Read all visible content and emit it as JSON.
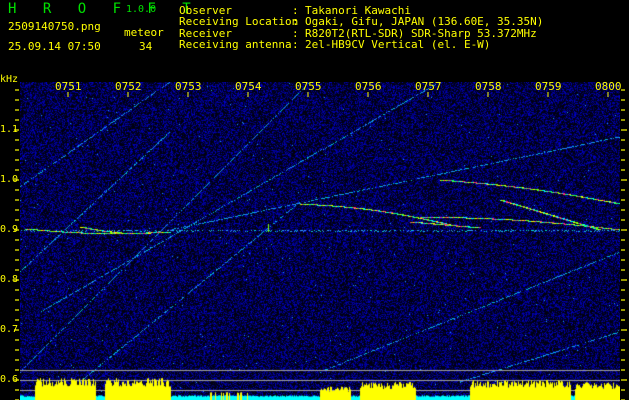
{
  "header": {
    "app_name": "H R O F F T",
    "version": "1.0.0",
    "filename": "2509140750.png",
    "datetime": "25.09.14 07:50",
    "meteor_label": "meteor",
    "meteor_count": "34",
    "info": [
      {
        "label": "Observer",
        "value": "Takanori Kawachi"
      },
      {
        "label": "Receiving Location",
        "value": "Ogaki, Gifu, JAPAN (136.60E, 35.35N)"
      },
      {
        "label": "Receiver",
        "value": "R820T2(RTL-SDR) SDR-Sharp 53.372MHz"
      },
      {
        "label": "Receiving antenna",
        "value": "2el-HB9CV Vertical (el. E-W)"
      }
    ]
  },
  "spectrogram": {
    "y_unit": "kHz",
    "y_ticks": [
      "1.1",
      "1.0",
      "0.9",
      "0.8",
      "0.7",
      "0.6"
    ],
    "y_range_khz": [
      0.56,
      1.2
    ],
    "x_ticks": [
      "0751",
      "0752",
      "0753",
      "0754",
      "0755",
      "0756",
      "0757",
      "0758",
      "0759",
      "0800"
    ],
    "colors": {
      "background": "#000000",
      "noise": "#1010c0",
      "text": "#ffff00",
      "logo": "#00e000",
      "histogram": "#ffff00",
      "histogram_base": "#00ffff",
      "threshold_lines": "#a0a0a0"
    }
  }
}
